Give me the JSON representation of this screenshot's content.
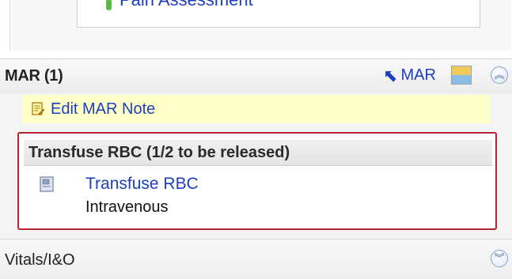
{
  "top_section": {
    "pain_item_label": "Pain Assessment"
  },
  "mar": {
    "title": "MAR (1)",
    "link_label": "MAR",
    "edit_note_label": "Edit MAR Note",
    "order_group": {
      "header": "Transfuse RBC (1/2 to be released)",
      "item_name": "Transfuse RBC",
      "item_route": "Intravenous"
    }
  },
  "vitals": {
    "label": "Vitals/I&O"
  },
  "icons": {
    "collapse": "double-chevron-up-icon",
    "expand": "double-chevron-down-icon",
    "mar_link": "arrow-up-left-icon",
    "legend": "color-legend-icon",
    "note": "note-icon",
    "order_doc": "document-icon",
    "status_dot": "green-status-icon"
  },
  "colors": {
    "link_blue": "#1b3fbf",
    "highlight_yellow": "#ffffc8",
    "selection_red": "#b3262e",
    "status_green": "#58b947"
  }
}
